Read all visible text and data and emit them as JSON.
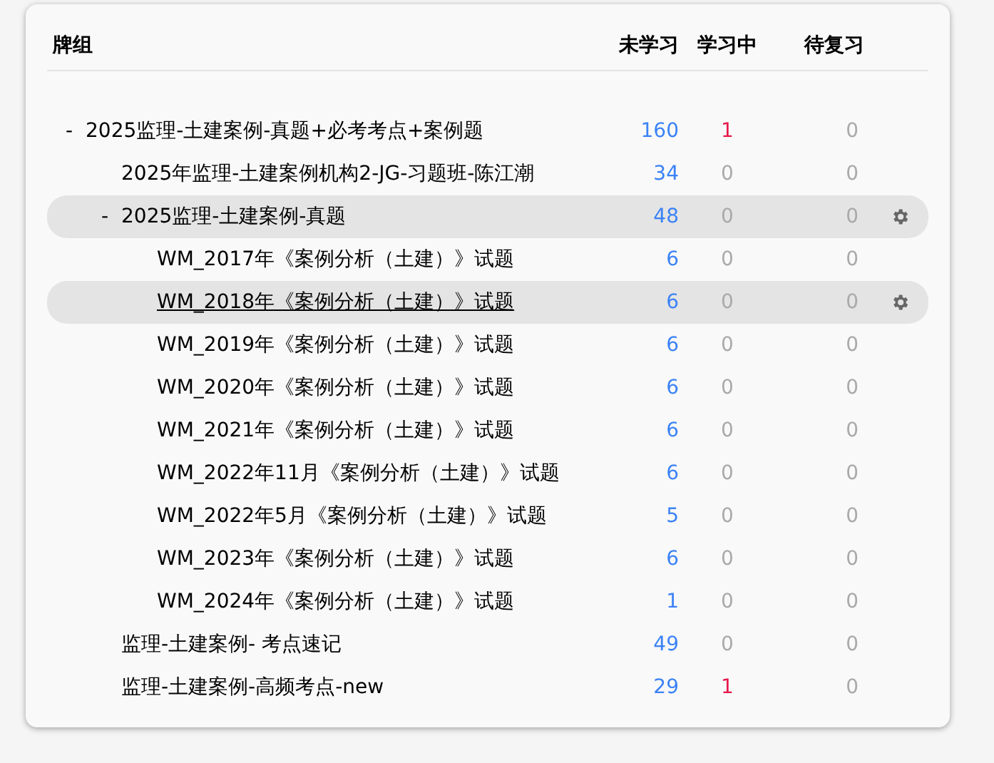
{
  "columns": [
    "牌组",
    "未学习",
    "学习中",
    "待复习"
  ],
  "decks": [
    {
      "name": "2025监理-土建案例-真题+必考考点+案例题",
      "toggle": "-",
      "new": "160",
      "learn": "1",
      "review": "0",
      "selected": false,
      "hovered": false,
      "children": [
        {
          "name": "2025年监理-土建案例机构2-JG-习题班-陈江潮",
          "new": "34",
          "learn": "0",
          "review": "0",
          "selected": false,
          "hovered": false
        },
        {
          "name": "2025监理-土建案例-真题",
          "toggle": "-",
          "new": "48",
          "learn": "0",
          "review": "0",
          "selected": true,
          "hovered": false,
          "children": [
            {
              "name": "WM_2017年《案例分析（土建）》试题",
              "new": "6",
              "learn": "0",
              "review": "0",
              "selected": false,
              "hovered": false
            },
            {
              "name": "WM_2018年《案例分析（土建）》试题",
              "new": "6",
              "learn": "0",
              "review": "0",
              "selected": true,
              "hovered": true
            },
            {
              "name": "WM_2019年《案例分析（土建）》试题",
              "new": "6",
              "learn": "0",
              "review": "0",
              "selected": false,
              "hovered": false
            },
            {
              "name": "WM_2020年《案例分析（土建）》试题",
              "new": "6",
              "learn": "0",
              "review": "0",
              "selected": false,
              "hovered": false
            },
            {
              "name": "WM_2021年《案例分析（土建）》试题",
              "new": "6",
              "learn": "0",
              "review": "0",
              "selected": false,
              "hovered": false
            },
            {
              "name": "WM_2022年11月《案例分析（土建）》试题",
              "new": "6",
              "learn": "0",
              "review": "0",
              "selected": false,
              "hovered": false
            },
            {
              "name": "WM_2022年5月《案例分析（土建）》试题",
              "new": "5",
              "learn": "0",
              "review": "0",
              "selected": false,
              "hovered": false
            },
            {
              "name": "WM_2023年《案例分析（土建）》试题",
              "new": "6",
              "learn": "0",
              "review": "0",
              "selected": false,
              "hovered": false
            },
            {
              "name": "WM_2024年《案例分析（土建）》试题",
              "new": "1",
              "learn": "0",
              "review": "0",
              "selected": false,
              "hovered": false
            }
          ]
        },
        {
          "name": "监理-土建案例- 考点速记",
          "new": "49",
          "learn": "0",
          "review": "0",
          "selected": false,
          "hovered": false
        },
        {
          "name": "监理-土建案例-高频考点-new",
          "new": "29",
          "learn": "1",
          "review": "0",
          "selected": false,
          "hovered": false
        }
      ]
    }
  ]
}
